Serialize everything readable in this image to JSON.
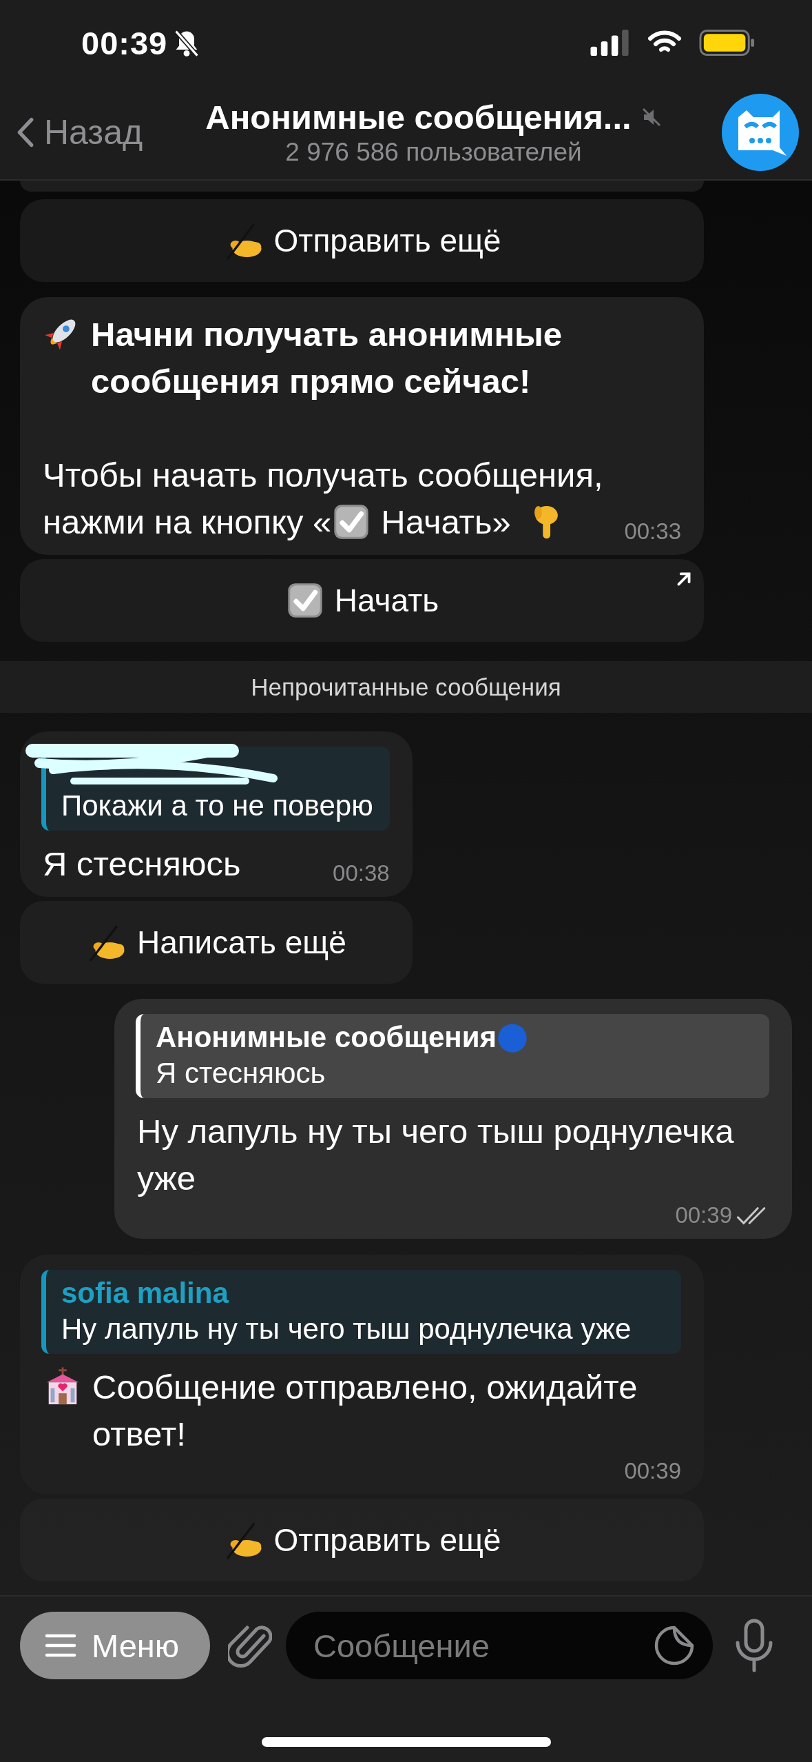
{
  "status_bar": {
    "time": "00:39",
    "silent": true
  },
  "header": {
    "back": "Назад",
    "title": "Анонимные сообщения...",
    "muted": true,
    "subtitle": "2 976 586 пользователей"
  },
  "chat": [
    {
      "kind": "keyboard",
      "buttons": [
        {
          "label": "Отправить ещё",
          "opens_link": false
        }
      ]
    },
    {
      "kind": "promo",
      "heading": "Начни получать анонимные сообщения прямо сейчас!",
      "text": "Чтобы начать получать сообщения,",
      "hint_before": "нажми на кнопку «",
      "hint_after": "Начать»",
      "time": "00:33",
      "keyboard": [
        {
          "label": "Начать",
          "opens_link": true
        }
      ]
    },
    {
      "kind": "unread",
      "text": "Непрочитанные сообщения"
    },
    {
      "kind": "incoming",
      "reply": {
        "text": "Покажи а то не поверю",
        "redacted": true
      },
      "text": "Я стесняюсь",
      "time": "00:38",
      "keyboard": [
        {
          "label": "Написать ещё",
          "opens_link": false
        }
      ]
    },
    {
      "kind": "outgoing",
      "reply": {
        "author": "Анонимные сообщения",
        "text": "Я стесняюсь"
      },
      "text": "Ну лапуль ну ты чего тыш роднулечка уже",
      "time": "00:39",
      "read": true
    },
    {
      "kind": "notice",
      "reply": {
        "author": "sofia malina",
        "text": "Ну лапуль ну ты чего тыш роднулечка уже"
      },
      "text": "Сообщение отправлено, ожидайте ответ!",
      "time": "00:39",
      "keyboard": [
        {
          "label": "Отправить ещё",
          "opens_link": false
        }
      ]
    }
  ],
  "input_bar": {
    "menu": "Меню",
    "placeholder": "Сообщение"
  }
}
